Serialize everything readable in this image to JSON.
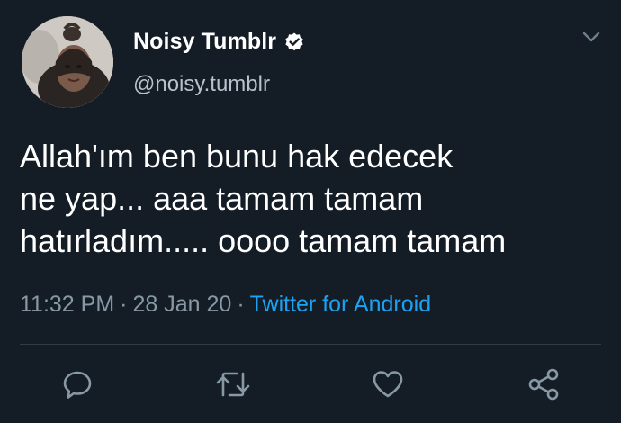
{
  "user": {
    "display_name": "Noisy Tumblr",
    "handle": "@noisy.tumblr",
    "verified": true
  },
  "tweet": {
    "lines": [
      "Allah'ım ben bunu hak edecek",
      "ne yap... aaa tamam tamam",
      "hatırladım..... oooo tamam tamam"
    ]
  },
  "meta": {
    "time": "11:32 PM",
    "date": "28 Jan 20",
    "separator": "·",
    "source": "Twitter for Android"
  },
  "actions": [
    {
      "icon": "reply-icon"
    },
    {
      "icon": "retweet-icon"
    },
    {
      "icon": "like-icon"
    },
    {
      "icon": "share-icon"
    }
  ],
  "colors": {
    "background": "#141d26",
    "text": "#ffffff",
    "secondary": "#8899a6",
    "link": "#1da1f2",
    "verified": "#ffffff"
  }
}
